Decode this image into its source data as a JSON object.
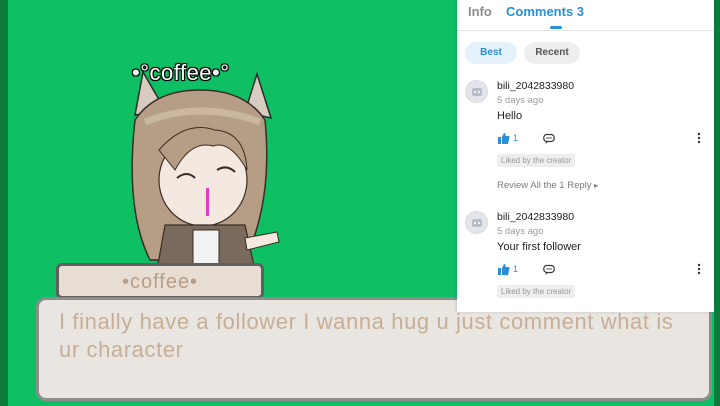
{
  "scene": {
    "character_title": "•°coffee•°",
    "name_plate": "•coffee•",
    "dialogue": "I finally have a follower I wanna hug u just comment what is ur character"
  },
  "panel": {
    "tabs": [
      {
        "label": "Info"
      },
      {
        "label": "Comments 3"
      }
    ],
    "sort": {
      "best": "Best",
      "recent": "Recent"
    },
    "comments": [
      {
        "user": "bili_2042833980",
        "time": "5 days ago",
        "text": "Hello",
        "likes": "1",
        "liked_badge": "Liked by the creator",
        "replies_link": "Review All the 1 Reply"
      },
      {
        "user": "bili_2042833980",
        "time": "5 days ago",
        "text": "Your first follower",
        "likes": "1",
        "liked_badge": "Liked by the creator"
      }
    ]
  },
  "colors": {
    "green_screen": "#0fbf63",
    "accent": "#2a8fd8",
    "dialog_text": "#c7ae96"
  },
  "icons": [
    "thumbs-up-icon",
    "comment-bubble-icon",
    "more-vertical-icon",
    "avatar-placeholder-icon"
  ]
}
